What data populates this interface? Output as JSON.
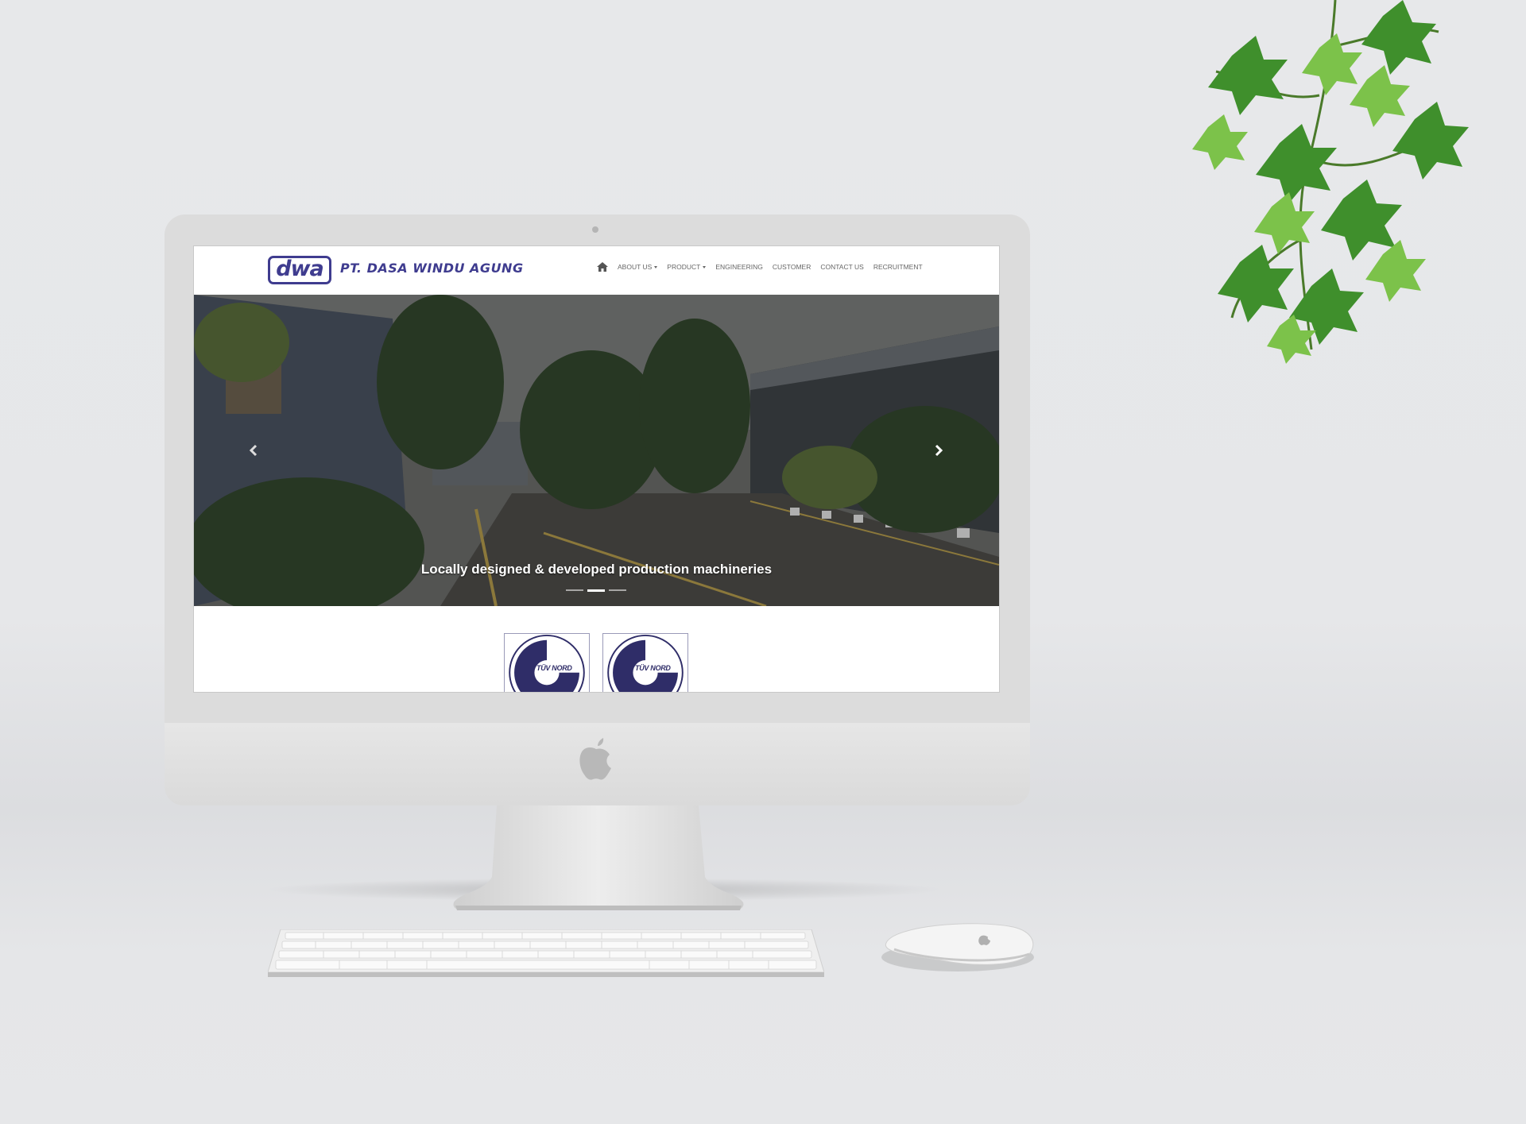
{
  "site": {
    "logo_text": "dwa",
    "company_name": "PT. DASA WINDU AGUNG",
    "brand_color": "#3f3c8f",
    "nav": {
      "home_icon": "home-icon",
      "items": [
        {
          "label": "ABOUT US",
          "dropdown": true
        },
        {
          "label": "PRODUCT",
          "dropdown": true
        },
        {
          "label": "ENGINEERING",
          "dropdown": false
        },
        {
          "label": "CUSTOMER",
          "dropdown": false
        },
        {
          "label": "CONTACT US",
          "dropdown": false
        },
        {
          "label": "RECRUITMENT",
          "dropdown": false
        }
      ]
    },
    "hero": {
      "caption": "Locally designed & developed production machineries",
      "slides": 3,
      "active_slide": 2
    },
    "certificates": [
      {
        "label": "TÜV NORD"
      },
      {
        "label": "TÜV NORD"
      }
    ]
  }
}
